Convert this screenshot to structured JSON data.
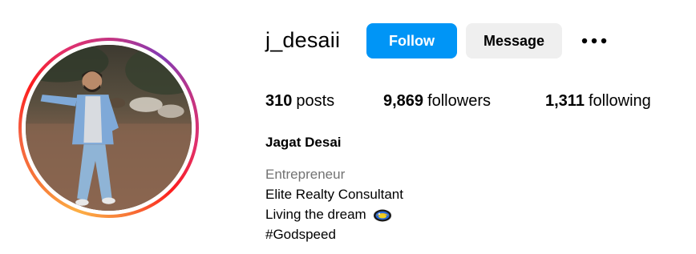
{
  "profile": {
    "username": "j_desaii",
    "full_name": "Jagat Desai",
    "category": "Entrepreneur",
    "bio_lines": [
      "Elite Realty Consultant",
      "Living the dream",
      "#Godspeed"
    ],
    "bio_emoji": "helmet-emoji"
  },
  "actions": {
    "follow_label": "Follow",
    "message_label": "Message",
    "more_icon": "more-horizontal-icon"
  },
  "stats": {
    "posts": {
      "count": "310",
      "label": "posts"
    },
    "followers": {
      "count": "9,869",
      "label": "followers"
    },
    "following": {
      "count": "1,311",
      "label": "following"
    }
  },
  "colors": {
    "follow_button": "#0095f6",
    "message_button": "#efefef",
    "category_text": "#737373",
    "ring_gradient": [
      "#fcaf45",
      "#fd1d1d",
      "#e1306c",
      "#c13584",
      "#833ab4"
    ]
  }
}
